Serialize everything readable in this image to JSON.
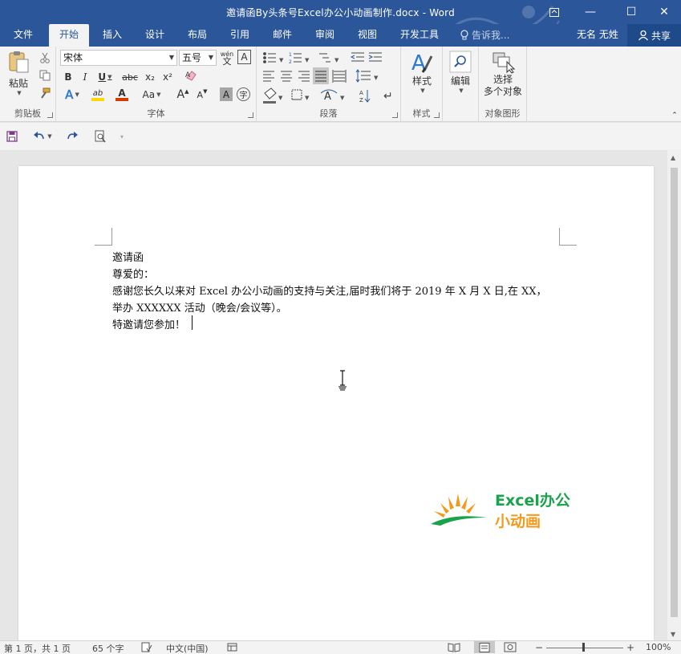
{
  "window": {
    "title": "邀请函By头条号Excel办公小动画制作.docx - Word",
    "controls": {
      "ribbon_display": "ribbon-display-icon",
      "minimize": "—",
      "restore": "☐",
      "close": "✕"
    }
  },
  "tabs": [
    {
      "label": "文件"
    },
    {
      "label": "开始",
      "active": true
    },
    {
      "label": "插入"
    },
    {
      "label": "设计"
    },
    {
      "label": "布局"
    },
    {
      "label": "引用"
    },
    {
      "label": "邮件"
    },
    {
      "label": "审阅"
    },
    {
      "label": "视图"
    },
    {
      "label": "开发工具"
    }
  ],
  "tell_me": "告诉我...",
  "user_name": "无名 无姓",
  "share_label": "共享",
  "ribbon": {
    "clipboard": {
      "label": "剪贴板",
      "paste": "粘贴"
    },
    "font": {
      "label": "字体",
      "font_name": "宋体",
      "font_size": "五号",
      "wen": "wén",
      "wen_char": "文",
      "a_box": "A",
      "bold": "B",
      "italic": "I",
      "underline": "U",
      "strike": "abc",
      "subscript": "x₂",
      "superscript": "x²",
      "grow": "A",
      "shrink": "A",
      "case": "Aa",
      "char_shading": "A",
      "char_border": "字",
      "highlight": "ab",
      "font_color": "A",
      "highlight_color": "#ffd800",
      "font_color_value": "#d83b01"
    },
    "paragraph": {
      "label": "段落"
    },
    "styles": {
      "label": "样式",
      "button": "样式"
    },
    "editing": {
      "button": "编辑"
    },
    "objects": {
      "label": "对象图形",
      "button_line1": "选择",
      "button_line2": "多个对象"
    }
  },
  "document": {
    "lines": [
      "邀请函",
      "尊爱的：",
      "感谢您长久以来对 Excel 办公小动画的支持与关注,届时我们将于 2019 年 X 月 X 日,在 XX，",
      "举办 XXXXXX 活动（晚会/会议等）。",
      "特邀请您参加！"
    ],
    "logo": {
      "line1": "Excel办公",
      "line2": "小动画",
      "green": "#1aa34a",
      "orange": "#f39a1e"
    }
  },
  "status": {
    "page": "第 1 页，共 1 页",
    "words": "65 个字",
    "language": "中文(中国)",
    "zoom": "100%"
  },
  "colors": {
    "accent": "#2b579a"
  }
}
